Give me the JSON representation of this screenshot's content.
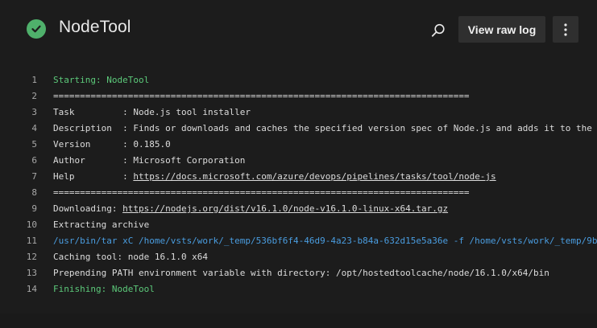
{
  "header": {
    "title": "NodeTool",
    "status_icon": "check-circle-icon",
    "status_color": "#4fb06b",
    "view_raw_label": "View raw log",
    "search_icon": "search-icon",
    "more_icon": "more-vertical-icon"
  },
  "log": {
    "lines": [
      {
        "n": "1",
        "pre": "Starting: NodeTool",
        "link": "",
        "post": "",
        "style": "green"
      },
      {
        "n": "2",
        "pre": "==============================================================================",
        "link": "",
        "post": "",
        "style": "normal"
      },
      {
        "n": "3",
        "pre": "Task         : Node.js tool installer",
        "link": "",
        "post": "",
        "style": "normal"
      },
      {
        "n": "4",
        "pre": "Description  : Finds or downloads and caches the specified version spec of Node.js and adds it to the PATH",
        "link": "",
        "post": "",
        "style": "normal"
      },
      {
        "n": "5",
        "pre": "Version      : 0.185.0",
        "link": "",
        "post": "",
        "style": "normal"
      },
      {
        "n": "6",
        "pre": "Author       : Microsoft Corporation",
        "link": "",
        "post": "",
        "style": "normal"
      },
      {
        "n": "7",
        "pre": "Help         : ",
        "link": "https://docs.microsoft.com/azure/devops/pipelines/tasks/tool/node-js",
        "post": "",
        "style": "normal"
      },
      {
        "n": "8",
        "pre": "==============================================================================",
        "link": "",
        "post": "",
        "style": "normal"
      },
      {
        "n": "9",
        "pre": "Downloading: ",
        "link": "https://nodejs.org/dist/v16.1.0/node-v16.1.0-linux-x64.tar.gz",
        "post": "",
        "style": "normal"
      },
      {
        "n": "10",
        "pre": "Extracting archive",
        "link": "",
        "post": "",
        "style": "normal"
      },
      {
        "n": "11",
        "pre": "/usr/bin/tar xC /home/vsts/work/_temp/536bf6f4-46d9-4a23-b84a-632d15e5a36e -f /home/vsts/work/_temp/9b",
        "link": "",
        "post": "",
        "style": "cmd"
      },
      {
        "n": "12",
        "pre": "Caching tool: node 16.1.0 x64",
        "link": "",
        "post": "",
        "style": "normal"
      },
      {
        "n": "13",
        "pre": "Prepending PATH environment variable with directory: /opt/hostedtoolcache/node/16.1.0/x64/bin",
        "link": "",
        "post": "",
        "style": "normal"
      },
      {
        "n": "14",
        "pre": "Finishing: NodeTool",
        "link": "",
        "post": "",
        "style": "green"
      }
    ]
  }
}
